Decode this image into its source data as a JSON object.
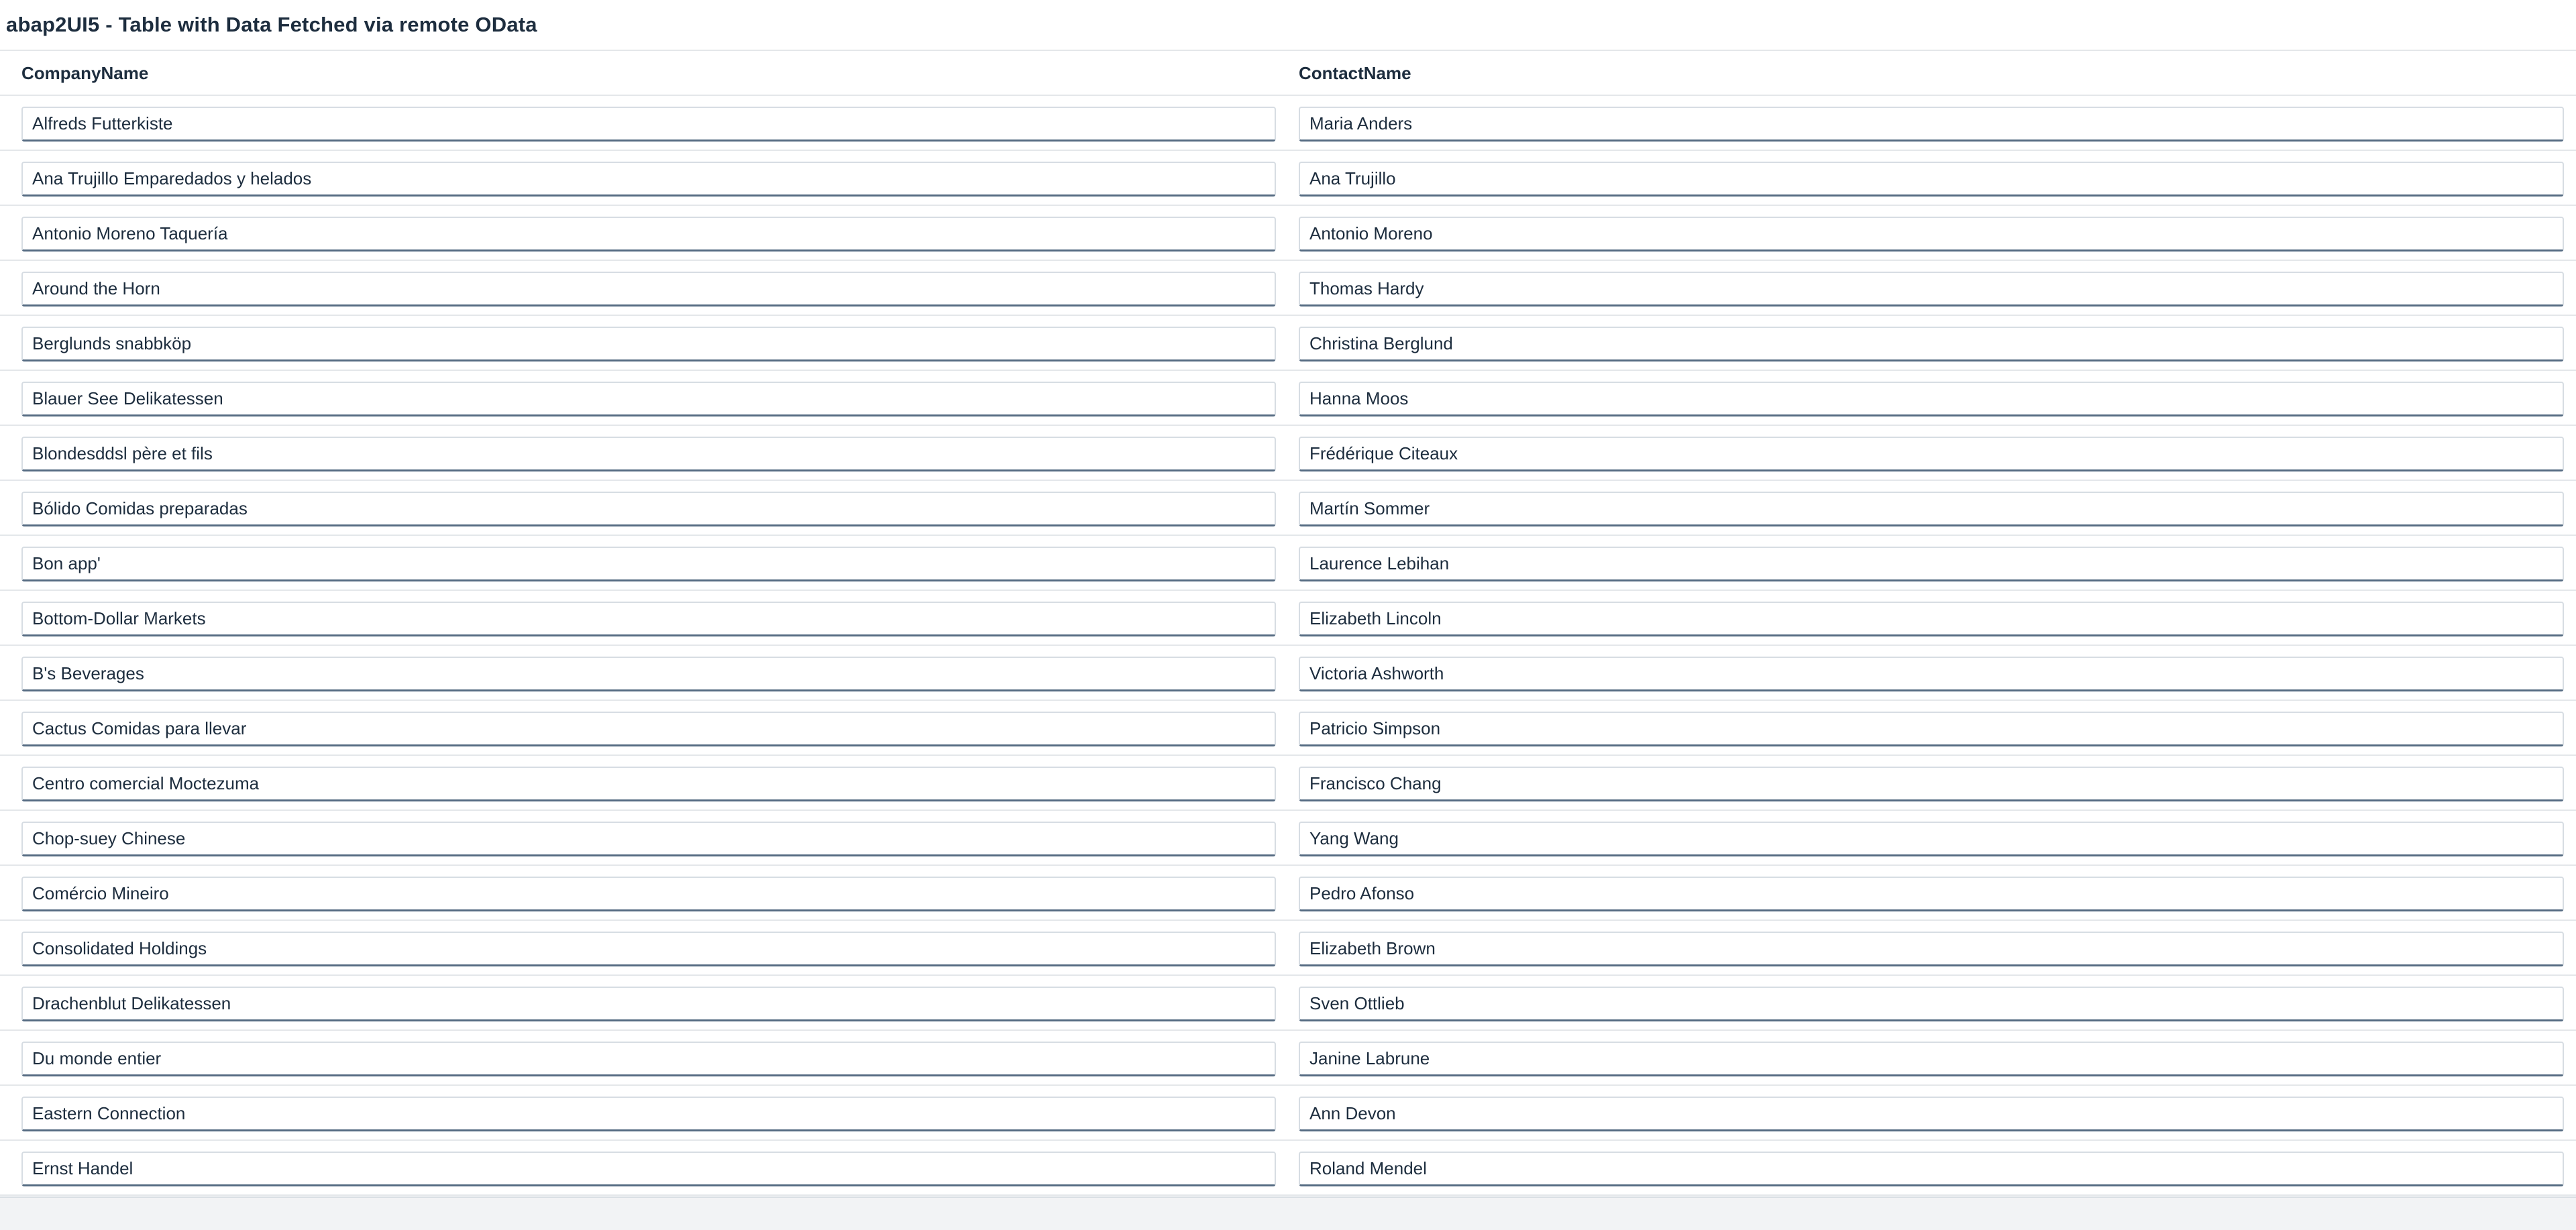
{
  "page": {
    "title": "abap2UI5 - Table with Data Fetched via remote OData"
  },
  "table": {
    "columns": [
      "CompanyName",
      "ContactName"
    ],
    "rows": [
      {
        "company": "Alfreds Futterkiste",
        "contact": "Maria Anders"
      },
      {
        "company": "Ana Trujillo Emparedados y helados",
        "contact": "Ana Trujillo"
      },
      {
        "company": "Antonio Moreno Taquería",
        "contact": "Antonio Moreno"
      },
      {
        "company": "Around the Horn",
        "contact": "Thomas Hardy"
      },
      {
        "company": "Berglunds snabbköp",
        "contact": "Christina Berglund"
      },
      {
        "company": "Blauer See Delikatessen",
        "contact": "Hanna Moos"
      },
      {
        "company": "Blondesddsl père et fils",
        "contact": "Frédérique Citeaux"
      },
      {
        "company": "Bólido Comidas preparadas",
        "contact": "Martín Sommer"
      },
      {
        "company": "Bon app'",
        "contact": "Laurence Lebihan"
      },
      {
        "company": "Bottom-Dollar Markets",
        "contact": "Elizabeth Lincoln"
      },
      {
        "company": "B's Beverages",
        "contact": "Victoria Ashworth"
      },
      {
        "company": "Cactus Comidas para llevar",
        "contact": "Patricio Simpson"
      },
      {
        "company": "Centro comercial Moctezuma",
        "contact": "Francisco Chang"
      },
      {
        "company": "Chop-suey Chinese",
        "contact": "Yang Wang"
      },
      {
        "company": "Comércio Mineiro",
        "contact": "Pedro Afonso"
      },
      {
        "company": "Consolidated Holdings",
        "contact": "Elizabeth Brown"
      },
      {
        "company": "Drachenblut Delikatessen",
        "contact": "Sven Ottlieb"
      },
      {
        "company": "Du monde entier",
        "contact": "Janine Labrune"
      },
      {
        "company": "Eastern Connection",
        "contact": "Ann Devon"
      },
      {
        "company": "Ernst Handel",
        "contact": "Roland Mendel"
      }
    ]
  },
  "colors": {
    "text": "#1d2d3e",
    "border": "#e4e7ea",
    "input_border": "#d7dde3",
    "input_bottom_border": "#556b82",
    "footer_background": "#f2f3f5"
  }
}
